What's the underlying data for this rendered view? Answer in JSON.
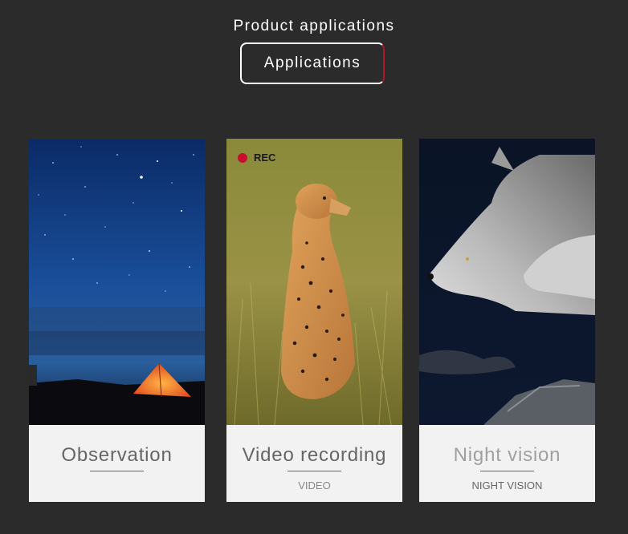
{
  "header": {
    "title": "Product applications",
    "button_label": "Applications"
  },
  "cards": [
    {
      "title": "Observation",
      "subtitle": ""
    },
    {
      "title": "Video recording",
      "subtitle": "VIDEO",
      "overlay": "REC"
    },
    {
      "title": "Night vision",
      "subtitle": "NIGHT VISION"
    }
  ],
  "colors": {
    "background": "#2b2b2b",
    "accent": "#a8192e",
    "caption_bg": "#f2f2f2"
  }
}
